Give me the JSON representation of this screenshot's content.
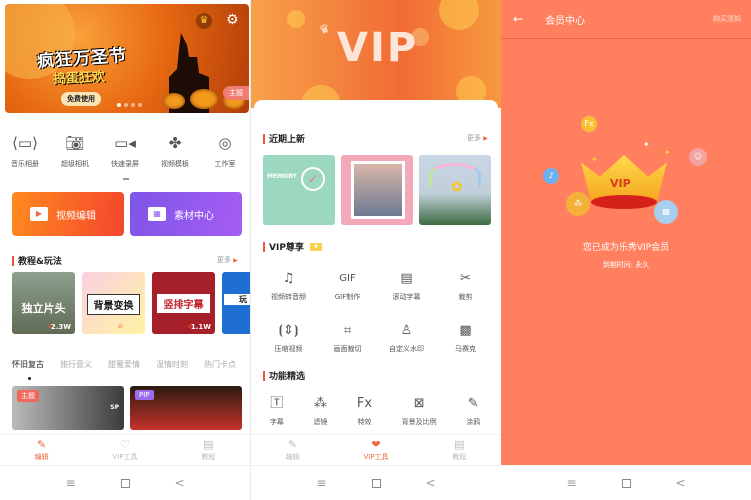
{
  "panel1": {
    "banner": {
      "title": "疯狂万圣节",
      "subtitle": "捣蛋狂欢",
      "cta": "免费使用",
      "theme_tag": "主题",
      "vip_icon": "crown-icon",
      "settings_icon": "gear-icon"
    },
    "tools": [
      {
        "label": "音乐相册",
        "icon": "photo-album-icon"
      },
      {
        "label": "超级相机",
        "icon": "camera-icon"
      },
      {
        "label": "快速录屏",
        "icon": "screen-record-icon"
      },
      {
        "label": "视频模板",
        "icon": "template-icon"
      },
      {
        "label": "工作室",
        "icon": "studio-icon"
      }
    ],
    "big_buttons": [
      {
        "label": "视频编辑",
        "icon": "video-edit-icon"
      },
      {
        "label": "素材中心",
        "icon": "store-icon"
      }
    ],
    "tutorials": {
      "title": "教程&玩法",
      "more": "更多",
      "cards": [
        {
          "text": "独立片头",
          "count": "2.3W"
        },
        {
          "text": "背景变换",
          "count": ""
        },
        {
          "text": "竖排字幕",
          "count": "1.1W"
        },
        {
          "text": "玩",
          "count": ""
        }
      ]
    },
    "categories": [
      "怀旧复古",
      "旅行意义",
      "甜蜜爱情",
      "温情时刻",
      "热门卡点"
    ],
    "videos": [
      {
        "tag": "主题",
        "badge": "SP"
      },
      {
        "tag": "PIP",
        "badge": ""
      }
    ],
    "tabbar": [
      {
        "label": "编辑",
        "icon": "edit-icon",
        "active": true
      },
      {
        "label": "VIP工具",
        "icon": "vip-icon",
        "active": false
      },
      {
        "label": "教程",
        "icon": "tutorial-icon",
        "active": false
      }
    ]
  },
  "panel2": {
    "banner_text": "VIP",
    "recent": {
      "title": "近期上新",
      "more": "更多",
      "cards": [
        "MEMORY",
        "相框",
        "彩虹"
      ]
    },
    "vip_exclusive": {
      "title": "VIP尊享",
      "items": [
        {
          "label": "视频转音频",
          "icon": "music-note-icon"
        },
        {
          "label": "GIF制作",
          "icon": "gif-icon"
        },
        {
          "label": "滚动字幕",
          "icon": "scroll-subtitle-icon"
        },
        {
          "label": "裁剪",
          "icon": "scissors-icon"
        },
        {
          "label": "压缩视频",
          "icon": "compress-icon"
        },
        {
          "label": "画面裁切",
          "icon": "crop-icon"
        },
        {
          "label": "自定义水印",
          "icon": "stamp-icon"
        },
        {
          "label": "马赛克",
          "icon": "mosaic-icon"
        }
      ]
    },
    "features": {
      "title": "功能精选",
      "items": [
        {
          "label": "字幕",
          "icon": "text-icon"
        },
        {
          "label": "滤镜",
          "icon": "filter-icon"
        },
        {
          "label": "特效",
          "icon": "fx-icon"
        },
        {
          "label": "背景及比例",
          "icon": "aspect-ratio-icon"
        },
        {
          "label": "涂鸦",
          "icon": "pen-icon"
        }
      ]
    },
    "tabbar": [
      {
        "label": "编辑",
        "icon": "edit-icon",
        "active": false
      },
      {
        "label": "VIP工具",
        "icon": "vip-icon",
        "active": true
      },
      {
        "label": "教程",
        "icon": "tutorial-icon",
        "active": false
      }
    ]
  },
  "panel3": {
    "title": "会员中心",
    "notice": "购买须知",
    "crown_text": "VIP",
    "message": "您已成为乐秀VIP会员",
    "expiry": "到期时间: 永久",
    "bg_color": "#ff7f5e"
  },
  "system_nav": {
    "menu": "≡",
    "home": "□",
    "back": "<"
  },
  "colors": {
    "accent": "#f06a3f",
    "vip_bg": "#ff7f5e"
  }
}
